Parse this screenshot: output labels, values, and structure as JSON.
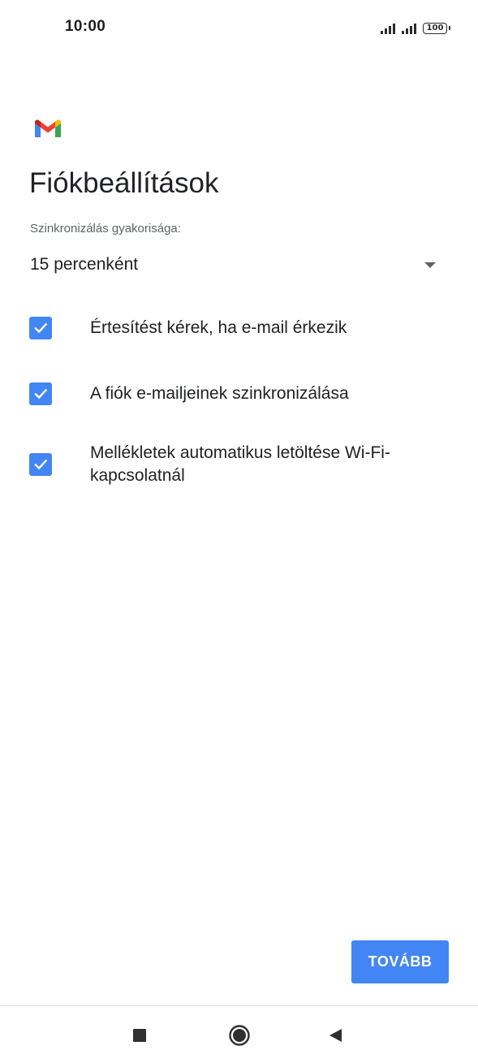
{
  "status_bar": {
    "time": "10:00",
    "battery": "100"
  },
  "app": {
    "logo_icon": "gmail-logo-icon"
  },
  "page": {
    "title": "Fiókbeállítások"
  },
  "sync": {
    "label": "Szinkronizálás gyakorisága:",
    "value": "15 percenként"
  },
  "options": [
    {
      "label": "Értesítést kérek, ha e-mail érkezik",
      "checked": true
    },
    {
      "label": "A fiók e-mailjeinek szinkronizálása",
      "checked": true
    },
    {
      "label": "Mellékletek automatikus letöltése Wi-Fi-kapcsolatnál",
      "checked": true
    }
  ],
  "actions": {
    "next_label": "TOVÁBB"
  },
  "nav": {
    "recents_icon": "square-icon",
    "home_icon": "circle-icon",
    "back_icon": "triangle-back-icon"
  },
  "colors": {
    "accent": "#4285f4"
  }
}
